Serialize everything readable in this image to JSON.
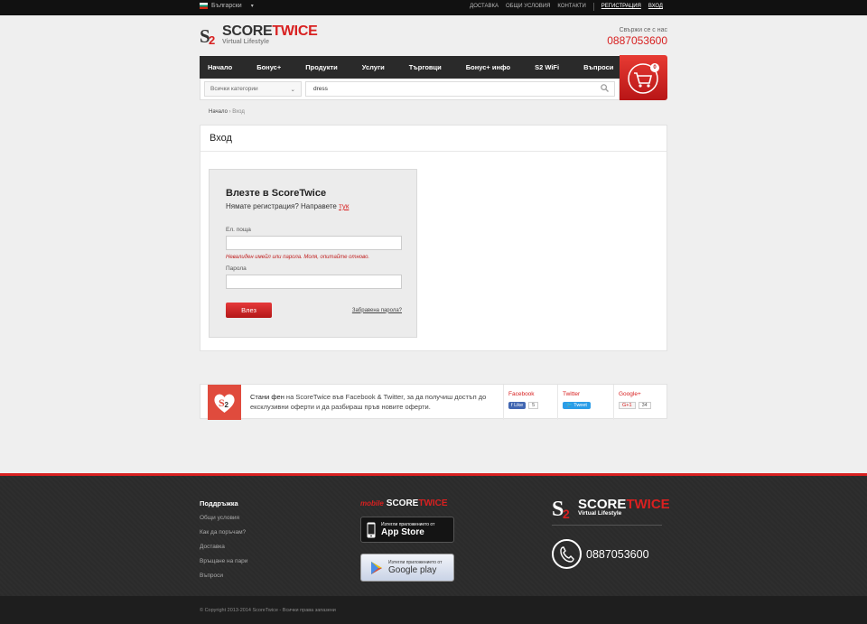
{
  "topbar": {
    "language": "Български",
    "links": [
      "ДОСТАВКА",
      "ОБЩИ УСЛОВИЯ",
      "КОНТАКТИ"
    ],
    "register": "РЕГИСТРАЦИЯ",
    "login": "ВХОД"
  },
  "header": {
    "logo_name_a": "SCORE",
    "logo_name_b": "TWICE",
    "logo_tagline": "Virtual Lifestyle",
    "contact_label": "Свържи се с нас",
    "contact_phone": "0887053600"
  },
  "nav": {
    "items": [
      "Начало",
      "Бонус+",
      "Продукти",
      "Услуги",
      "Търговци",
      "Бонус+ инфо",
      "S2 WiFi",
      "Въпроси"
    ],
    "cart_count": "0"
  },
  "search": {
    "category": "Всички категории",
    "query": "dress"
  },
  "breadcrumb": {
    "home": "Начало",
    "sep": "›",
    "current": "Вход"
  },
  "page": {
    "title": "Вход"
  },
  "login": {
    "heading": "Влезте в ScoreTwice",
    "register_text": "Нямате регистрация? Направете",
    "register_link": "тук",
    "email_label": "Ел. поща",
    "error": "Невалиден имейл или парола. Моля, опитайте отново.",
    "password_label": "Парола",
    "submit": "Влез",
    "forgot": "Забравена парола?"
  },
  "social": {
    "text_a": "Стани фен",
    "text_b": " на ScoreTwice във Facebook & Twitter, за да получиш достъп до ексклузивни оферти и да разбираш пръв новите оферти.",
    "facebook": {
      "label": "Facebook",
      "button": "Like",
      "count": "5"
    },
    "twitter": {
      "label": "Twitter",
      "button": "Tweet"
    },
    "google": {
      "label": "Google+",
      "button": "G+1",
      "count": "34"
    }
  },
  "footer": {
    "support_title": "Поддръжка",
    "support_links": [
      "Общи условия",
      "Как да поръчам?",
      "Доставка",
      "Връщане на пари",
      "Въпроси"
    ],
    "mobile_prefix": "mobile",
    "mobile_a": "SCORE",
    "mobile_b": "TWICE",
    "appstore_small": "Изтегли приложението от",
    "appstore_big": "App Store",
    "gplay_small": "Изтегли приложението от",
    "gplay_big": "Google play",
    "logo_a": "SCORE",
    "logo_b": "TWICE",
    "logo_tagline": "Virtual Lifestyle",
    "phone": "0887053600",
    "copyright": "© Copyright 2013-2014 ScoreTwice - Всички права запазени"
  },
  "colors": {
    "brand_red": "#d82020",
    "dark": "#2a2a2a"
  }
}
